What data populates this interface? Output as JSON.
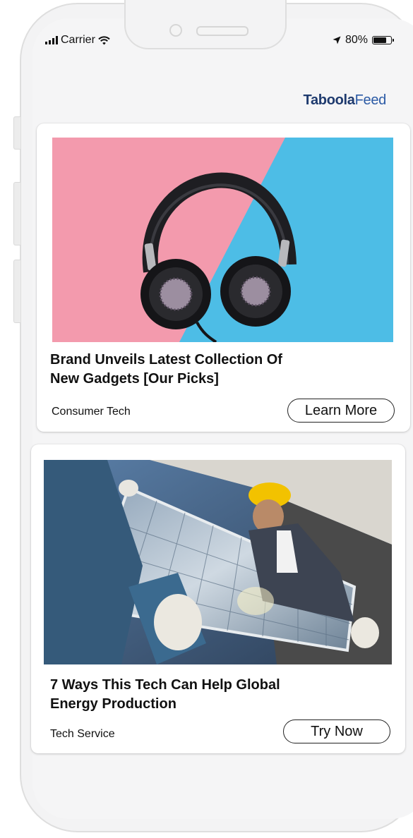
{
  "status_bar": {
    "carrier": "Carrier",
    "battery_percent": "80%",
    "battery_level": 0.8
  },
  "brand": {
    "name_bold": "Taboola",
    "name_light": "Feed"
  },
  "feed": {
    "items": [
      {
        "title_line1": "Brand Unveils Latest Collection Of",
        "title_line2": "New Gadgets [Our Picks]",
        "source": "Consumer Tech",
        "cta": "Learn More",
        "image": "headphones-image"
      },
      {
        "title_line1": "7 Ways This Tech Can Help Global",
        "title_line2": "Energy Production",
        "source": "Tech Service",
        "cta": "Try Now",
        "image": "solar-panel-image"
      }
    ]
  },
  "colors": {
    "brand": "#1e3a6e",
    "image_pink": "#f39aad",
    "image_blue": "#4dbde6"
  }
}
